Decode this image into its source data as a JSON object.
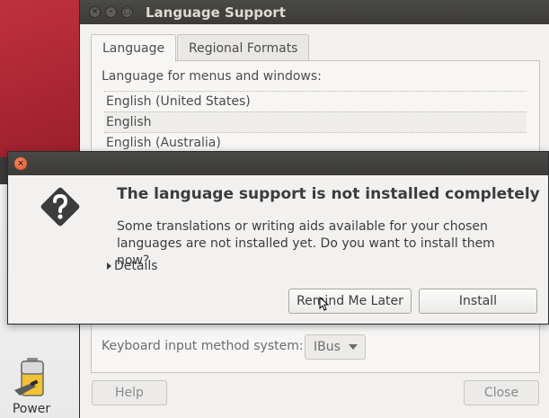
{
  "desktop": {
    "launcher_label": "Power",
    "launcher_icon": "battery-power-icon"
  },
  "language_support": {
    "title": "Language Support",
    "window_buttons": [
      "close",
      "minimize",
      "maximize"
    ],
    "tabs": [
      {
        "label": "Language",
        "active": true
      },
      {
        "label": "Regional Formats",
        "active": false
      }
    ],
    "list_caption": "Language for menus and windows:",
    "languages": [
      "English (United States)",
      "English",
      "English (Australia)"
    ],
    "keyboard_label": "Keyboard input method system:",
    "keyboard_value": "IBus",
    "help_button": "Help",
    "close_button": "Close"
  },
  "alert": {
    "icon": "question-icon",
    "heading": "The language support is not installed completely",
    "body_line1": "Some translations or writing aids available for your chosen",
    "body_line2": "languages are not installed yet. Do you want to install them now?",
    "details_label": "Details",
    "remind_button": "Remind Me Later",
    "install_button": "Install"
  },
  "colors": {
    "desktop_red": "#a92634",
    "titlebar": "#3c3b37",
    "close_button": "#e0532b",
    "window_bg": "#f2f1f0"
  }
}
